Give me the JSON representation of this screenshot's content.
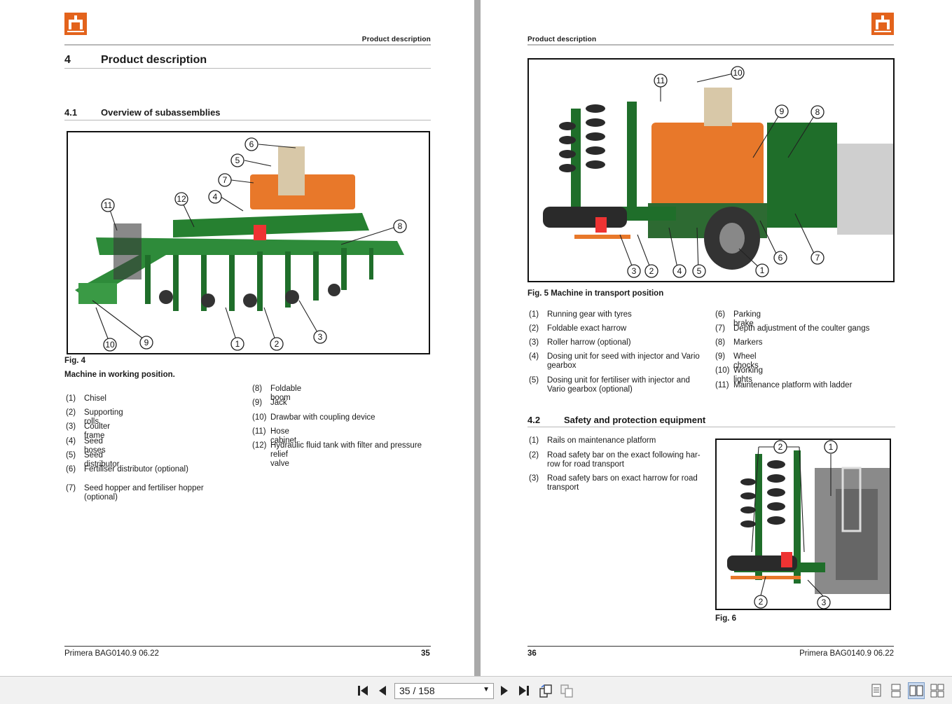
{
  "left_page": {
    "header": "Product description",
    "chapter": {
      "num": "4",
      "title": "Product description"
    },
    "section": {
      "num": "4.1",
      "title": "Overview of subassemblies"
    },
    "figure": {
      "caption_label": "Fig. 4",
      "caption_title": "Machine in working position.",
      "callouts": [
        "1",
        "2",
        "3",
        "4",
        "5",
        "6",
        "7",
        "8",
        "9",
        "10",
        "11",
        "12"
      ]
    },
    "items_col1": [
      {
        "num": "(1)",
        "text": "Chisel"
      },
      {
        "num": "(2)",
        "text": "Supporting rolls"
      },
      {
        "num": "(3)",
        "text": "Coulter frame"
      },
      {
        "num": "(4)",
        "text": "Seed hoses"
      },
      {
        "num": "(5)",
        "text": "Seed distributor"
      },
      {
        "num": "(6)",
        "text": "Fertiliser distributor (optional)"
      },
      {
        "num": "(7)",
        "text": "Seed hopper and fertiliser hopper",
        "text2": "(optional)"
      }
    ],
    "items_col2": [
      {
        "num": "(8)",
        "text": "Foldable boom"
      },
      {
        "num": "(9)",
        "text": "Jack"
      },
      {
        "num": "(10)",
        "text": "Drawbar with coupling device"
      },
      {
        "num": "(11)",
        "text": "Hose cabinet"
      },
      {
        "num": "(12)",
        "text": "Hydraulic fluid tank with filter and pressure",
        "text2": "relief valve"
      }
    ],
    "footer": {
      "doc": "Primera  BAG0140.9  06.22",
      "page": "35"
    }
  },
  "right_page": {
    "header": "Product description",
    "figure5": {
      "caption": "Fig. 5 Machine in transport position",
      "callouts": [
        "1",
        "2",
        "3",
        "4",
        "5",
        "6",
        "7",
        "8",
        "9",
        "10",
        "11"
      ]
    },
    "items_col1": [
      {
        "num": "(1)",
        "text": "Running gear with tyres"
      },
      {
        "num": "(2)",
        "text": "Foldable exact harrow"
      },
      {
        "num": "(3)",
        "text": "Roller harrow (optional)"
      },
      {
        "num": "(4)",
        "text": "Dosing unit for seed with injector and Vario",
        "text2": "gearbox"
      },
      {
        "num": "(5)",
        "text": "Dosing unit for fertiliser with injector and",
        "text2": "Vario gearbox (optional)"
      }
    ],
    "items_col2": [
      {
        "num": "(6)",
        "text": "Parking brake"
      },
      {
        "num": "(7)",
        "text": "Depth adjustment of the coulter gangs"
      },
      {
        "num": "(8)",
        "text": "Markers"
      },
      {
        "num": "(9)",
        "text": "Wheel chocks"
      },
      {
        "num": "(10)",
        "text": "Working lights"
      },
      {
        "num": "(11)",
        "text": "Maintenance platform with ladder"
      }
    ],
    "section": {
      "num": "4.2",
      "title": "Safety and protection equipment"
    },
    "safety_items": [
      {
        "num": "(1)",
        "text": "Rails on maintenance platform"
      },
      {
        "num": "(2)",
        "text": "Road safety bar on the exact following har-",
        "text2": "row for road transport"
      },
      {
        "num": "(3)",
        "text": "Road safety bars on exact harrow for road",
        "text2": "transport"
      }
    ],
    "figure6": {
      "caption": "Fig. 6",
      "callouts": [
        "1",
        "2",
        "2",
        "3"
      ]
    },
    "footer": {
      "page": "36",
      "doc": "Primera  BAG0140.9  06.22"
    }
  },
  "toolbar": {
    "page_display": "35 / 158",
    "icons": [
      "first-page-icon",
      "prev-page-icon",
      "next-page-icon",
      "last-page-icon",
      "rotate-icon",
      "rotate-alt-icon",
      "single-page-icon",
      "continuous-icon",
      "two-page-icon",
      "two-page-continuous-icon"
    ]
  },
  "colors": {
    "brand_orange": "#e3631c",
    "machine_green": "#2e8b3a",
    "hopper_orange": "#e8782a",
    "viewer_bg": "#a9a9a9"
  }
}
